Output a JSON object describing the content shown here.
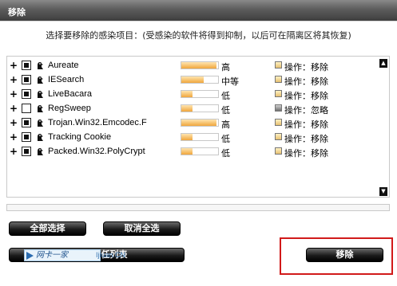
{
  "window": {
    "title": "移除"
  },
  "instruction": "选择要移除的感染项目：(受感染的软件将得到抑制，以后可在隔离区将其恢复)",
  "list": {
    "rows": [
      {
        "name": "Aureate",
        "level": "高",
        "level_fraction": 0.95,
        "checked": true,
        "action": "操作：移除",
        "action_type": "remove"
      },
      {
        "name": "IESearch",
        "level": "中等",
        "level_fraction": 0.6,
        "checked": true,
        "action": "操作：移除",
        "action_type": "remove"
      },
      {
        "name": "LiveBacara",
        "level": "低",
        "level_fraction": 0.3,
        "checked": true,
        "action": "操作：移除",
        "action_type": "remove"
      },
      {
        "name": "RegSweep",
        "level": "低",
        "level_fraction": 0.3,
        "checked": false,
        "action": "操作：忽略",
        "action_type": "ignore"
      },
      {
        "name": "Trojan.Win32.Emcodec.F",
        "level": "高",
        "level_fraction": 0.95,
        "checked": true,
        "action": "操作：移除",
        "action_type": "remove"
      },
      {
        "name": "Tracking Cookie",
        "level": "低",
        "level_fraction": 0.3,
        "checked": true,
        "action": "操作：移除",
        "action_type": "remove"
      },
      {
        "name": "Packed.Win32.PolyCrypt",
        "level": "低",
        "level_fraction": 0.3,
        "checked": true,
        "action": "操作：移除",
        "action_type": "remove"
      }
    ],
    "expand_symbol": "+"
  },
  "scrollbar": {
    "up_icon": "triangle-up",
    "down_icon": "triangle-down"
  },
  "buttons": {
    "select_all": "全部选择",
    "deselect_all": "取消全选",
    "trust_list": "添加到信任列表",
    "remove": "移除"
  },
  "watermark": {
    "text": "网卡一家",
    "sub": "Ijiuan.CN"
  },
  "colors": {
    "accent_red": "#d11a1a",
    "bar_fill": "#f0a63c"
  }
}
